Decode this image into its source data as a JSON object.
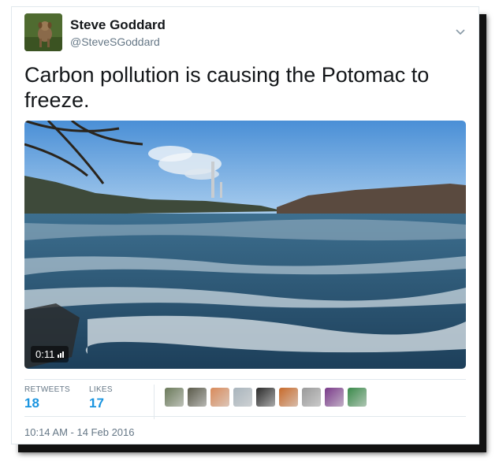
{
  "author": {
    "name": "Steve Goddard",
    "handle": "@SteveSGoddard"
  },
  "tweet": {
    "text": "Carbon pollution is causing the Potomac to freeze."
  },
  "video": {
    "duration": "0:11"
  },
  "stats": {
    "retweets_label": "RETWEETS",
    "retweets_count": "18",
    "likes_label": "LIKES",
    "likes_count": "17"
  },
  "likers": [
    {
      "icon": "liker-avatar-1",
      "color": "#6b7a5a"
    },
    {
      "icon": "liker-avatar-2",
      "color": "#5a5a4a"
    },
    {
      "icon": "liker-avatar-3",
      "color": "#d98a5a"
    },
    {
      "icon": "liker-avatar-4",
      "color": "#a8b4bc"
    },
    {
      "icon": "liker-avatar-5",
      "color": "#2a2a2a"
    },
    {
      "icon": "liker-avatar-6",
      "color": "#c86a2a"
    },
    {
      "icon": "liker-avatar-7",
      "color": "#9a9a9a"
    },
    {
      "icon": "liker-avatar-8",
      "color": "#7a3a8a"
    },
    {
      "icon": "liker-avatar-9",
      "color": "#3a8a4a"
    }
  ],
  "timestamp": "10:14 AM - 14 Feb 2016",
  "colors": {
    "link_blue": "#1b95e0",
    "secondary_text": "#657786",
    "primary_text": "#14171a"
  }
}
